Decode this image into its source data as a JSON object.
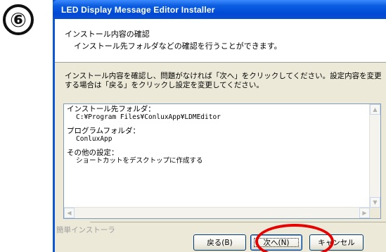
{
  "step_badge": "⑥",
  "window": {
    "title": "LED Display Message Editor Installer"
  },
  "header": {
    "title": "インストール内容の確認",
    "subtitle": "インストール先フォルダなどの確認を行うことができます。"
  },
  "instruction": "インストール内容を確認し、問題がなければ「次へ」をクリックしてください。設定内容を変更する場合は「戻る」をクリックし設定を変更してください。",
  "summary": {
    "install_folder_label": "インストール先フォルダ：",
    "install_folder_value": "C:¥Program Files¥ConluxApp¥LDMEditor",
    "program_folder_label": "プログラムフォルダ：",
    "program_folder_value": "ConluxApp",
    "other_label": "その他の設定：",
    "other_value": "ショートカットをデスクトップに作成する"
  },
  "footer": {
    "brand": "簡単インストーラ",
    "back_label": "戻る(B)",
    "next_label": "次へ(N)",
    "cancel_label": "キャンセル"
  },
  "colors": {
    "titlebar": "#0a4fd2",
    "dialog_face": "#ece9d8",
    "highlight": "#e60000"
  }
}
